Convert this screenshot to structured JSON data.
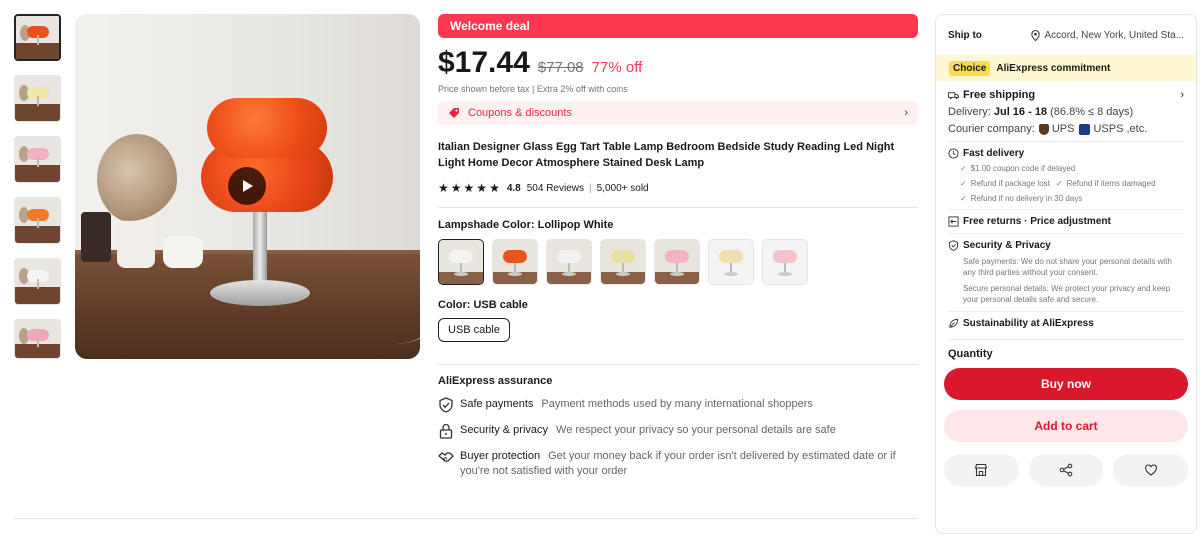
{
  "gallery": {
    "thumbnails": [
      {
        "shade_color": "#e8521e"
      },
      {
        "shade_color": "#f0e6a8"
      },
      {
        "shade_color": "#f2b2c0"
      },
      {
        "shade_color": "#f07a2a"
      },
      {
        "shade_color": "#f5f5f5"
      },
      {
        "shade_color": "#f0a8b6"
      }
    ]
  },
  "deal": {
    "banner": "Welcome deal"
  },
  "price": {
    "current": "$17.44",
    "original": "$77.08",
    "discount": "77% off",
    "note": "Price shown before tax  |  Extra 2% off with coins"
  },
  "coupons": {
    "label": "Coupons & discounts"
  },
  "product": {
    "title": "Italian Designer Glass Egg Tart Table Lamp Bedroom Bedside Study Reading Led Night Light Home Decor Atmosphere Stained Desk Lamp",
    "rating": "4.8",
    "stars": 5,
    "reviews": "504 Reviews",
    "sold": "5,000+ sold"
  },
  "options": {
    "lampshade_label": "Lampshade Color: Lollipop White",
    "lampshade_swatches": [
      {
        "shade": "#f4f4f2",
        "plain": false
      },
      {
        "shade": "#e8561e",
        "plain": false
      },
      {
        "shade": "#f2f2f0",
        "plain": false
      },
      {
        "shade": "#e8e0a0",
        "plain": false
      },
      {
        "shade": "#f2b4c2",
        "plain": false
      },
      {
        "shade": "#f0dfb0",
        "plain": true
      },
      {
        "shade": "#f5c2cc",
        "plain": true
      }
    ],
    "color_label": "Color: USB cable",
    "color_value": "USB cable"
  },
  "assurance": {
    "title": "AliExpress assurance",
    "items": [
      {
        "name": "Safe payments",
        "desc": "Payment methods used by many international shoppers",
        "icon": "shield-check-icon"
      },
      {
        "name": "Security & privacy",
        "desc": "We respect your privacy so your personal details are safe",
        "icon": "lock-icon"
      },
      {
        "name": "Buyer protection",
        "desc": "Get your money back if your order isn't delivered by estimated date or if you're not satisfied with your order",
        "icon": "handshake-icon"
      }
    ]
  },
  "shipping": {
    "ship_to_label": "Ship to",
    "location": "Accord, New York, United Sta...",
    "choice_badge": "Choice",
    "commitment": "AliExpress commitment",
    "free_shipping": "Free shipping",
    "delivery_prefix": "Delivery:",
    "delivery_dates": "Jul 16 - 18",
    "delivery_note": "(86.8% ≤ 8 days)",
    "courier_prefix": "Courier company:",
    "courier_ups": "UPS",
    "courier_usps": "USPS ,etc.",
    "fast_delivery": "Fast delivery",
    "fast_items": [
      "$1.00 coupon code if delayed",
      "Refund if package lost",
      "Refund if items damaged",
      "Refund if no delivery in 30 days"
    ],
    "returns": "Free returns · Price adjustment",
    "security_title": "Security & Privacy",
    "security_text1": "Safe payments: We do not share your personal details with any third parties without your consent.",
    "security_text2": "Secure personal details: We protect your privacy and keep your personal details safe and secure.",
    "sustainability": "Sustainability at AliExpress",
    "quantity_label": "Quantity",
    "buy_now": "Buy now",
    "add_to_cart": "Add to cart"
  },
  "colors": {
    "accent_red": "#fd384f",
    "buy_red": "#d9182b",
    "choice_yellow": "#f9de4b"
  }
}
